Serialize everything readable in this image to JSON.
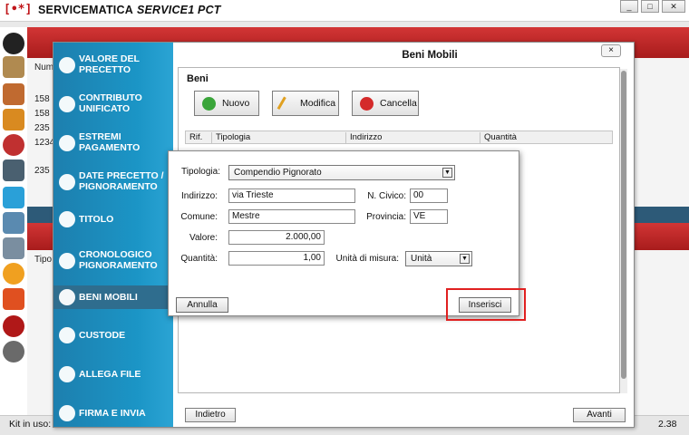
{
  "app": {
    "logo": "[•*]",
    "title": "SERVICEMATICA",
    "subtitle": "SERVICE1 PCT",
    "window_buttons": [
      "_",
      "□",
      "✕"
    ]
  },
  "background": {
    "list_header": "Num",
    "rows": [
      "158",
      "158",
      "235",
      "1234",
      "235"
    ],
    "tipo_label": "Tipo"
  },
  "status": {
    "kit_label": "Kit in uso:",
    "version": "2.38"
  },
  "dialog": {
    "title": "Beni Mobili",
    "close": "×",
    "steps": [
      {
        "label": "VALORE DEL PRECETTO",
        "icon": "scales-icon"
      },
      {
        "label": "CONTRIBUTO UNIFICATO",
        "icon": "receipt-icon"
      },
      {
        "label": "ESTREMI PAGAMENTO",
        "icon": "list-icon"
      },
      {
        "label": "DATE PRECETTO / PIGNORAMENTO",
        "icon": "calendar-icon"
      },
      {
        "label": "TITOLO",
        "icon": "dots-icon"
      },
      {
        "label": "CRONOLOGICO PIGNORAMENTO",
        "icon": "pie-icon"
      },
      {
        "label": "BENI MOBILI",
        "icon": "boxes-icon"
      },
      {
        "label": "CUSTODE",
        "icon": "person-icon"
      },
      {
        "label": "ALLEGA FILE",
        "icon": "pin-icon"
      },
      {
        "label": "FIRMA E INVIA",
        "icon": "send-icon"
      }
    ],
    "section_title": "Beni",
    "buttons": {
      "nuovo": "Nuovo",
      "modifica": "Modifica",
      "cancella": "Cancella"
    },
    "grid_columns": [
      "Rif.",
      "Tipologia",
      "Indirizzo",
      "Quantità"
    ],
    "indietro": "Indietro",
    "avanti": "Avanti"
  },
  "form": {
    "tipologia_label": "Tipologia:",
    "tipologia_value": "Compendio Pignorato",
    "indirizzo_label": "Indirizzo:",
    "indirizzo_value": "via Trieste",
    "civico_label": "N. Civico:",
    "civico_value": "00",
    "comune_label": "Comune:",
    "comune_value": "Mestre",
    "provincia_label": "Provincia:",
    "provincia_value": "VE",
    "valore_label": "Valore:",
    "valore_value": "2.000,00",
    "quantita_label": "Quantità:",
    "quantita_value": "1,00",
    "unita_label": "Unità di misura:",
    "unita_value": "Unità",
    "annulla": "Annulla",
    "inserisci": "Inserisci"
  },
  "colors": {
    "accent_red": "#c0161a",
    "wizard_blue": "#1b95c6",
    "highlight": "#e02020"
  }
}
